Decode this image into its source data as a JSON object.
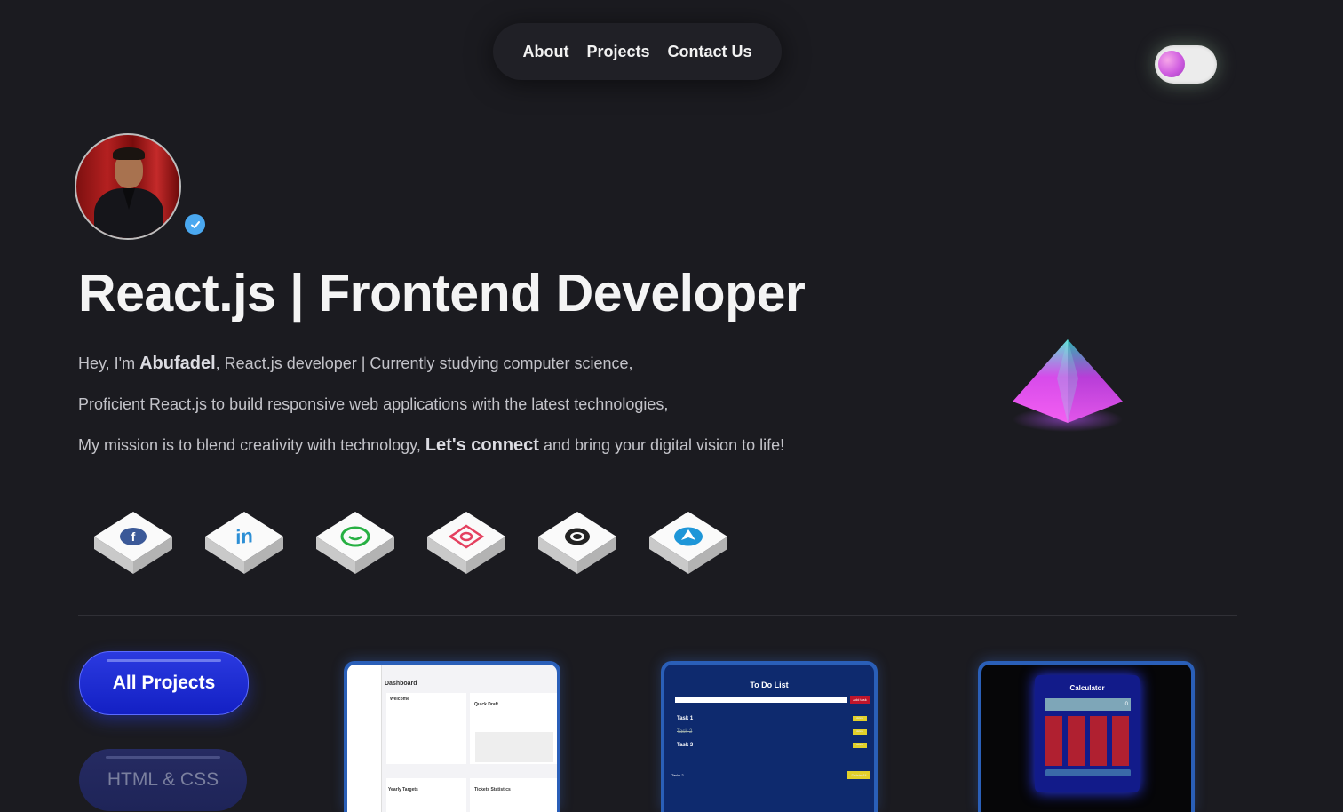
{
  "nav": {
    "items": [
      "About",
      "Projects",
      "Contact Us"
    ]
  },
  "hero": {
    "title": "React.js | Frontend Developer",
    "line1_a": "Hey, I'm ",
    "line1_name": "Abufadel",
    "line1_b": ", React.js developer | Currently studying computer science,",
    "line2": "Proficient React.js to build responsive web applications with the latest technologies,",
    "line3_a": "My mission is to blend creativity with technology, ",
    "line3_bold": "Let's connect",
    "line3_b": " and bring your digital vision to life!"
  },
  "social": [
    {
      "icon": "facebook-icon",
      "color": "#3b5998"
    },
    {
      "icon": "linkedin-icon",
      "color": "#2d8fd5"
    },
    {
      "icon": "whatsapp-icon",
      "color": "#27b043"
    },
    {
      "icon": "instagram-icon",
      "color": "#e4405f"
    },
    {
      "icon": "github-icon",
      "color": "#222222"
    },
    {
      "icon": "telegram-icon",
      "color": "#1e96d8"
    }
  ],
  "filters": {
    "all": "All Projects",
    "html_css": "HTML & CSS"
  },
  "projects": {
    "dashboard": {
      "title": "Dashboard",
      "welcome": "Welcome",
      "quick": "Quick Draft",
      "yearly": "Yearly Targets",
      "tickets": "Tickets Statistics"
    },
    "todo": {
      "title": "To Do List",
      "add": "Add task",
      "tasks": [
        "Task 1",
        "Task 2",
        "Task 3"
      ],
      "delete": "delete",
      "delete_all": "Delete All",
      "count": "Tasks 2"
    },
    "calculator": {
      "title": "Calculator",
      "display": "0"
    }
  }
}
